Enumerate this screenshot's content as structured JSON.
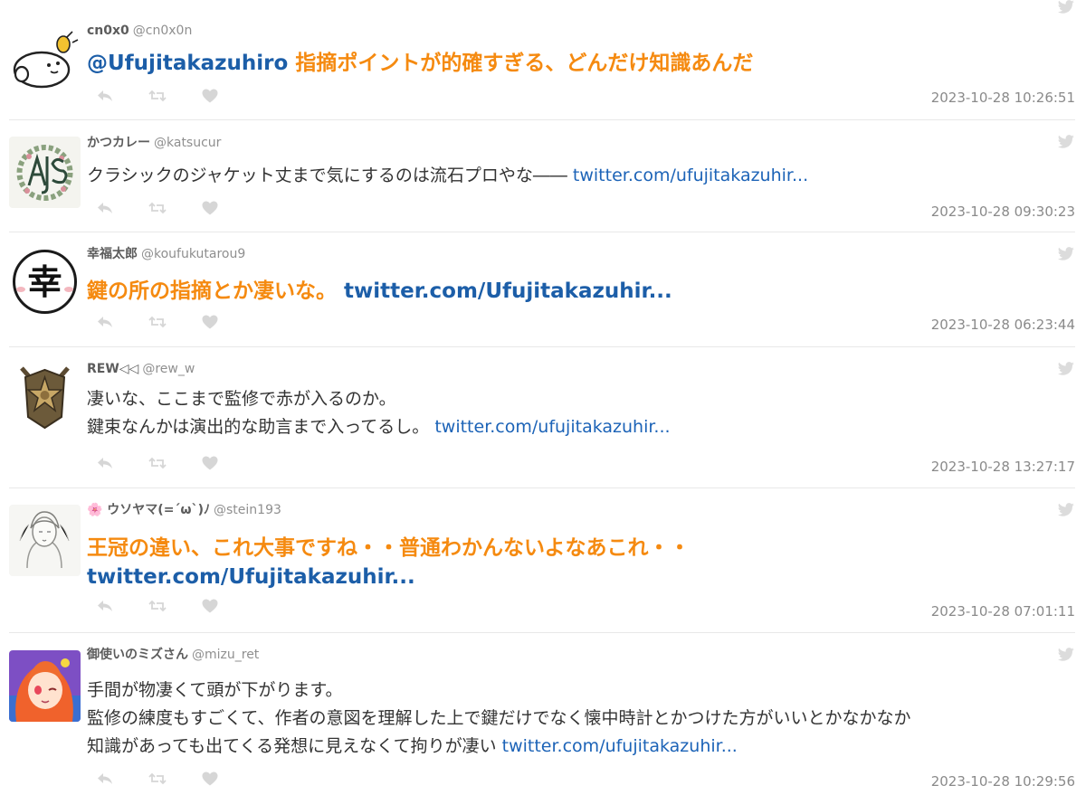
{
  "tweets": [
    {
      "display_name": "cn0x0",
      "handle": "@cn0x0n",
      "mention": "@Ufujitakazuhiro",
      "text": " 指摘ポイントが的確すぎる、どんだけ知識あんだ",
      "link": "",
      "timestamp": "2023-10-28 10:26:51"
    },
    {
      "display_name": "かつカレー",
      "handle": "@katsucur",
      "mention": "",
      "text": "クラシックのジャケット丈まで気にするのは流石プロやな―― ",
      "link": "twitter.com/ufujitakazuhir...",
      "timestamp": "2023-10-28 09:30:23"
    },
    {
      "display_name": "幸福太郎",
      "handle": "@koufukutarou9",
      "mention": "",
      "text": "鍵の所の指摘とか凄いな。 ",
      "link": "twitter.com/Ufujitakazuhir...",
      "timestamp": "2023-10-28 06:23:44",
      "avatar_glyph": "幸"
    },
    {
      "display_name": "REW◁◁",
      "handle": "@rew_w",
      "mention": "",
      "text": "凄いな、ここまで監修で赤が入るのか。\n鍵束なんかは演出的な助言まで入ってるし。 ",
      "link": "twitter.com/ufujitakazuhir...",
      "timestamp": "2023-10-28 13:27:17"
    },
    {
      "display_name": "🌸 ウソヤマ(=´ω`)ﾉ",
      "handle": "@stein193",
      "mention": "",
      "text": "王冠の違い、これ大事ですね・・普通わかんないよなあこれ・・\n",
      "link": "twitter.com/Ufujitakazuhir...",
      "timestamp": "2023-10-28 07:01:11"
    },
    {
      "display_name": "御使いのミズさん",
      "handle": "@mizu_ret",
      "mention": "",
      "text": "手間が物凄くて頭が下がります。\n監修の練度もすごくて、作者の意図を理解した上で鍵だけでなく懐中時計とかつけた方がいいとかなかなか\n知識があっても出てくる発想に見えなくて拘りが凄い ",
      "link": "twitter.com/ufujitakazuhir...",
      "timestamp": "2023-10-28 10:29:56"
    }
  ],
  "icons": {
    "bird": "twitter-bird-icon",
    "reply": "reply-icon",
    "retweet": "retweet-icon",
    "like": "heart-icon"
  },
  "colors": {
    "highlight_orange": "#f58a10",
    "link_blue": "#1c63b7",
    "meta_gray": "#8a8a8a",
    "icon_gray": "#d6d6d6"
  }
}
